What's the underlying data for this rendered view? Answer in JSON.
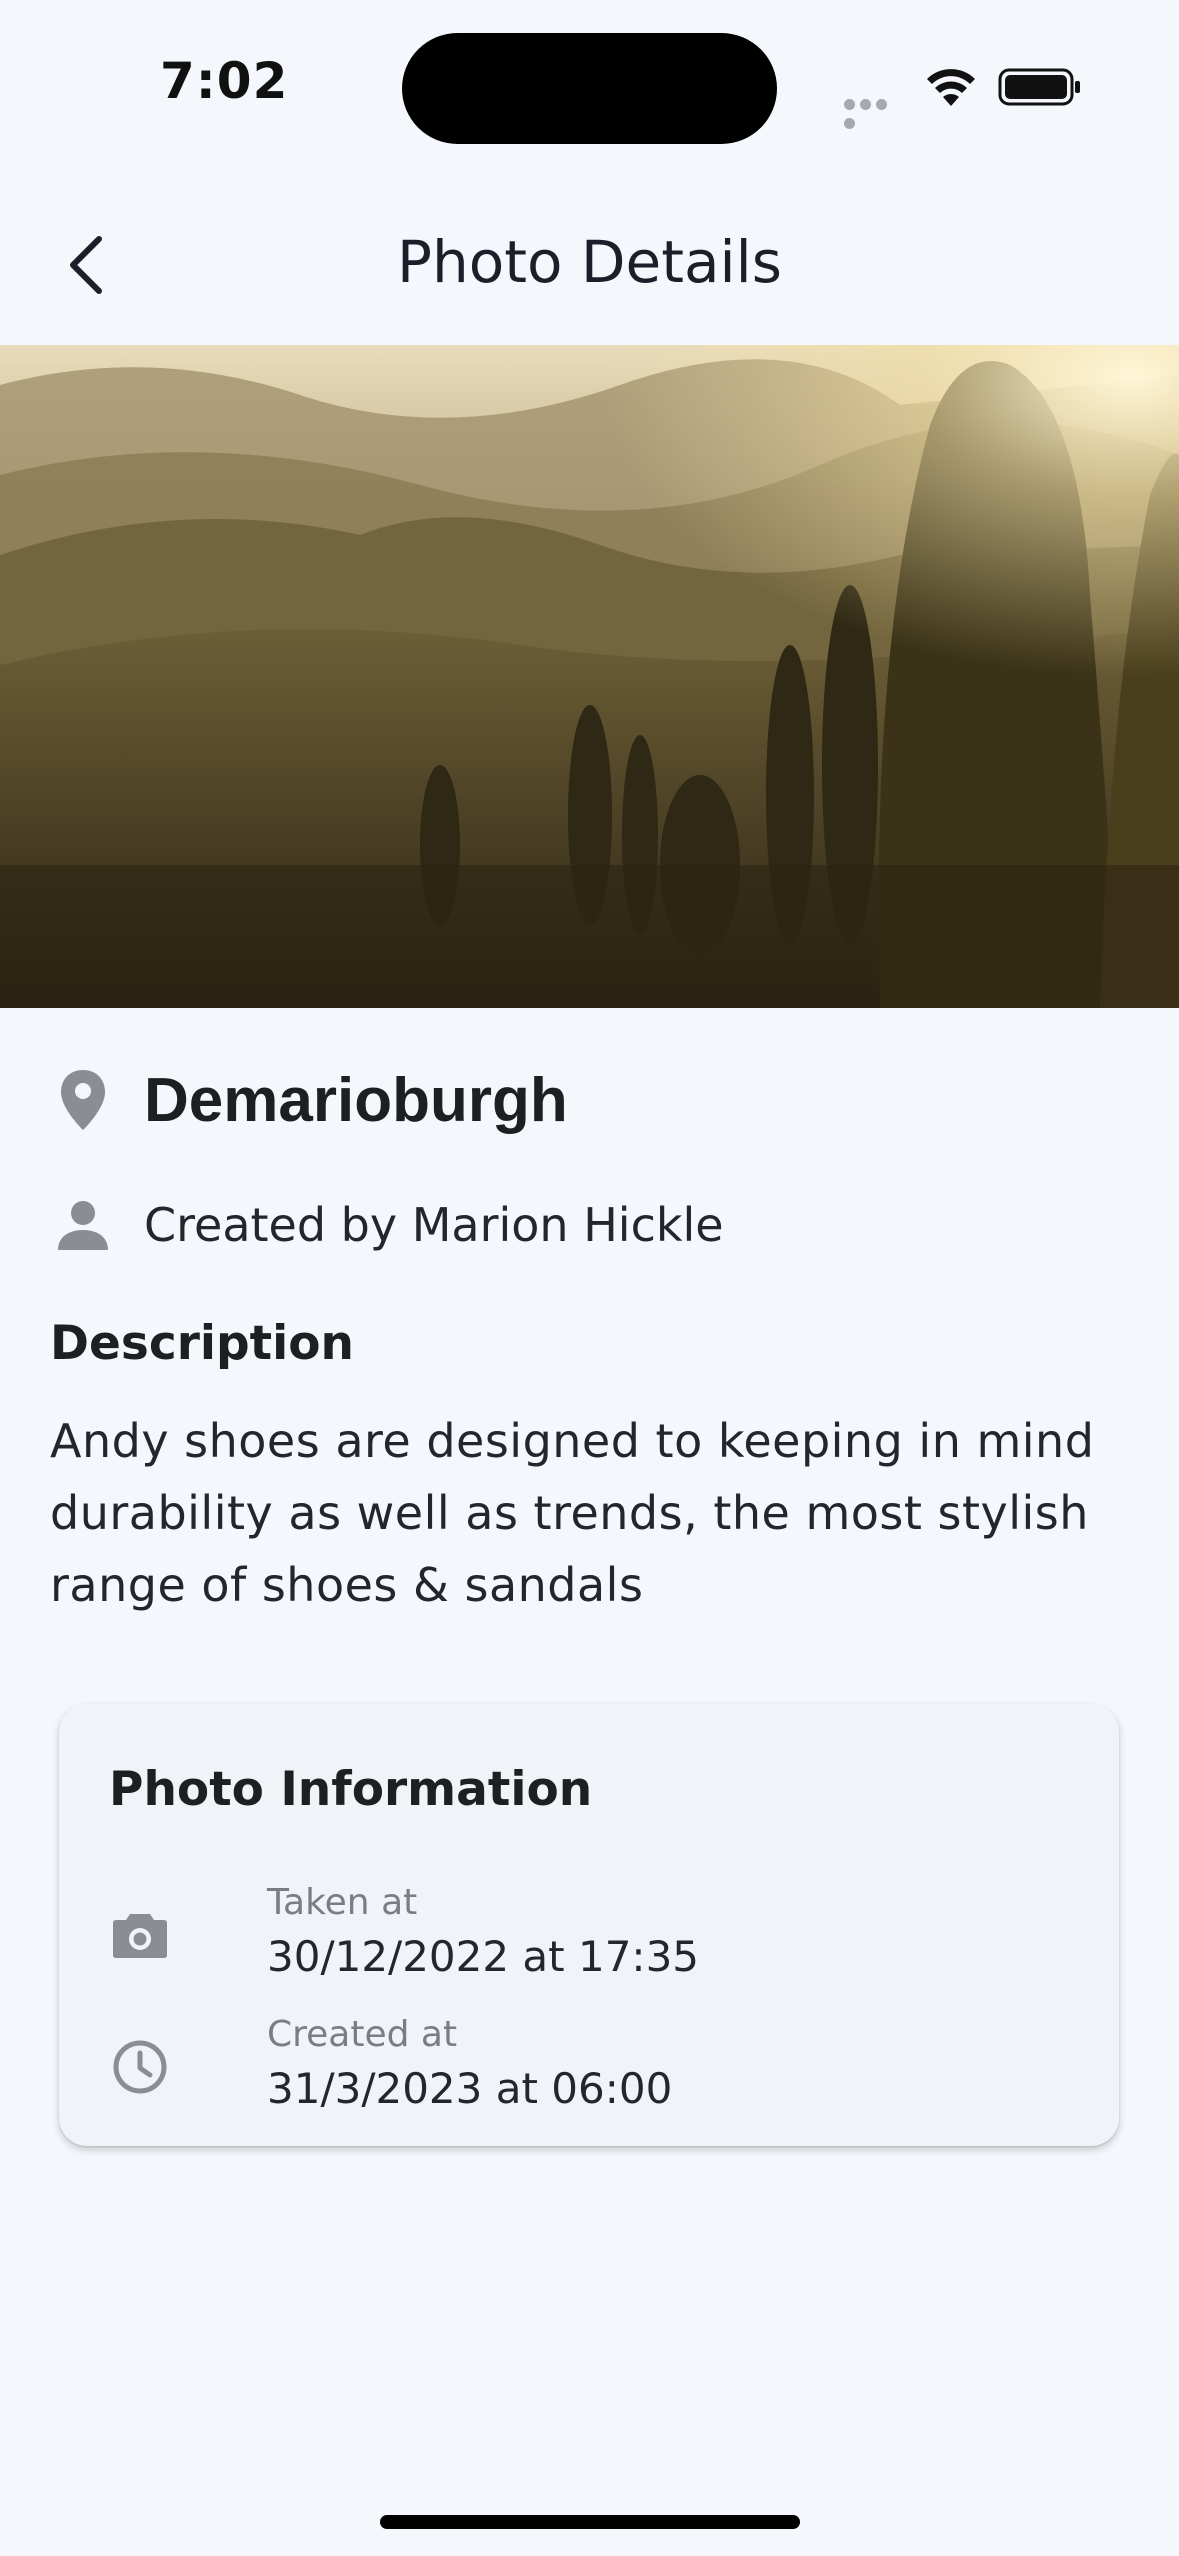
{
  "status_bar": {
    "time": "7:02"
  },
  "nav": {
    "title": "Photo Details",
    "back_icon": "chevron-left-icon"
  },
  "photo": {
    "location": "Demarioburgh",
    "location_icon": "map-pin-icon",
    "creator": "Created by Marion Hickle",
    "creator_icon": "person-icon"
  },
  "description": {
    "heading": "Description",
    "body": "Andy shoes are designed to keeping in mind durability as well as trends, the most stylish range of shoes & sandals"
  },
  "info_card": {
    "title": "Photo Information",
    "rows": [
      {
        "icon": "camera-icon",
        "label": "Taken at",
        "value": "30/12/2022 at 17:35"
      },
      {
        "icon": "clock-icon",
        "label": "Created at",
        "value": "31/3/2023 at 06:00"
      }
    ]
  },
  "colors": {
    "background": "#f4f8fc",
    "card_background": "#f0f3f7",
    "icon_gray": "#8a8d92",
    "text_primary": "#1d1f22",
    "text_secondary": "#7a7d82"
  }
}
